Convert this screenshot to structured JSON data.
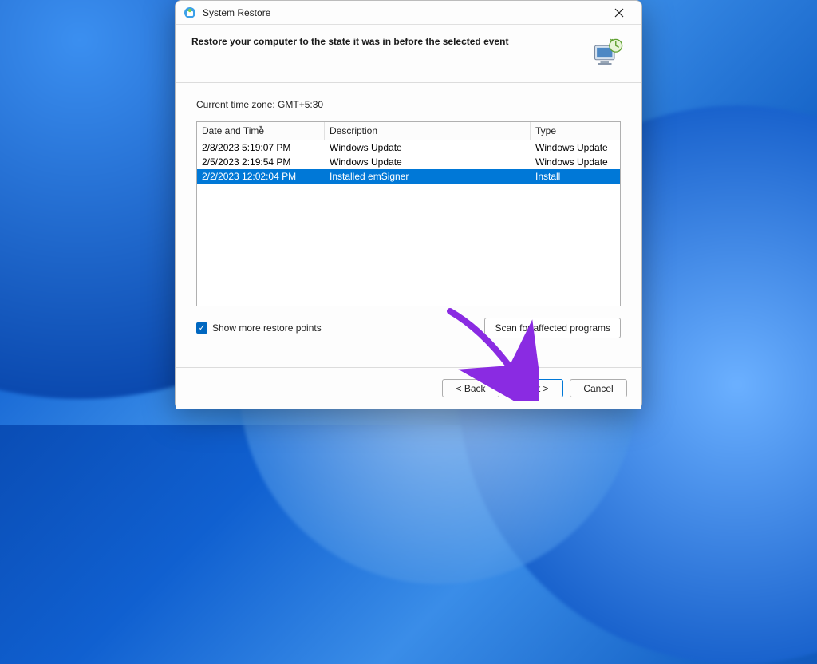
{
  "window": {
    "title": "System Restore"
  },
  "header": {
    "heading": "Restore your computer to the state it was in before the selected event"
  },
  "timezone_label": "Current time zone: GMT+5:30",
  "table": {
    "headers": {
      "datetime": "Date and Time",
      "description": "Description",
      "type": "Type"
    },
    "rows": [
      {
        "datetime": "2/8/2023 5:19:07 PM",
        "description": "Windows Update",
        "type": "Windows Update",
        "selected": false
      },
      {
        "datetime": "2/5/2023 2:19:54 PM",
        "description": "Windows Update",
        "type": "Windows Update",
        "selected": false
      },
      {
        "datetime": "2/2/2023 12:02:04 PM",
        "description": "Installed emSigner",
        "type": "Install",
        "selected": true
      }
    ]
  },
  "show_more": {
    "label": "Show more restore points",
    "checked": true
  },
  "scan_button": "Scan for affected programs",
  "footer": {
    "back": "< Back",
    "next": "Next >",
    "cancel": "Cancel"
  }
}
